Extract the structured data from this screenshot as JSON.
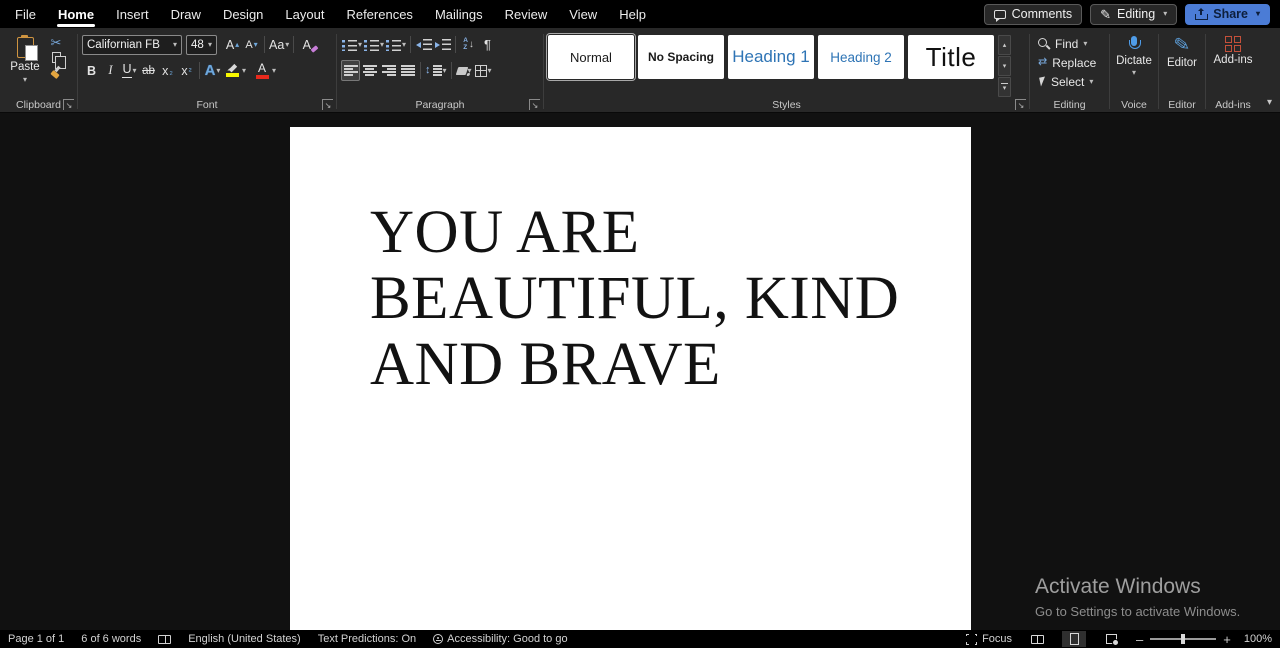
{
  "colors": {
    "accent_blue": "#4a90d9",
    "share_blue": "#4b7cd6",
    "heading_blue": "#2e74b5",
    "highlight_yellow": "#f7f700",
    "font_color_red": "#e8291c",
    "addins_orange": "#c4503a",
    "clipboard_orange": "#cf9440",
    "ribbon_bg": "#282828",
    "titlebar_bg": "#000000",
    "page_bg": "#ffffff"
  },
  "menu_bar": {
    "items": [
      "File",
      "Home",
      "Insert",
      "Draw",
      "Design",
      "Layout",
      "References",
      "Mailings",
      "Review",
      "View",
      "Help"
    ],
    "active": "Home"
  },
  "titlebar_actions": {
    "comments": "Comments",
    "editing": "Editing",
    "share": "Share"
  },
  "ribbon": {
    "clipboard": {
      "group_label": "Clipboard",
      "paste": "Paste"
    },
    "font": {
      "group_label": "Font",
      "family": "Californian FB",
      "size": "48",
      "grow": "A",
      "shrink": "A",
      "change_case": "Aa",
      "clear": "A",
      "bold": "B",
      "italic": "I",
      "underline": "U",
      "strikethrough": "ab",
      "sub_base": "x",
      "sub_mark": "₂",
      "sup_base": "x",
      "sup_mark": "²",
      "effects": "A",
      "font_color": "A"
    },
    "paragraph": {
      "group_label": "Paragraph",
      "sort_a": "A",
      "sort_z": "Z"
    },
    "styles": {
      "group_label": "Styles",
      "items": [
        {
          "label": "Normal"
        },
        {
          "label": "No Spacing"
        },
        {
          "label": "Heading 1"
        },
        {
          "label": "Heading 2"
        },
        {
          "label": "Title"
        }
      ]
    },
    "editing": {
      "group_label": "Editing",
      "find": "Find",
      "replace": "Replace",
      "select": "Select"
    },
    "voice": {
      "group_label": "Voice",
      "dictate": "Dictate"
    },
    "editor": {
      "group_label": "Editor",
      "editor": "Editor"
    },
    "addins": {
      "group_label": "Add-ins",
      "addins": "Add-ins"
    }
  },
  "document": {
    "lines": [
      "YOU ARE",
      "BEAUTIFUL, KIND",
      "AND BRAVE"
    ]
  },
  "watermark": {
    "title": "Activate Windows",
    "subtitle": "Go to Settings to activate Windows."
  },
  "status_bar": {
    "page": "Page 1 of 1",
    "words": "6 of 6 words",
    "language": "English (United States)",
    "predictions": "Text Predictions: On",
    "accessibility": "Accessibility: Good to go",
    "focus": "Focus",
    "zoom_level": "100%"
  },
  "icons": {
    "chevron": "▾",
    "up": "▴",
    "launcher": "↘",
    "cut": "✂",
    "pencil": "✎",
    "replace": "⇄",
    "sort_arrow": "↓",
    "updown": "↕",
    "pilcrow": "¶",
    "minus": "–",
    "plus": "+"
  }
}
